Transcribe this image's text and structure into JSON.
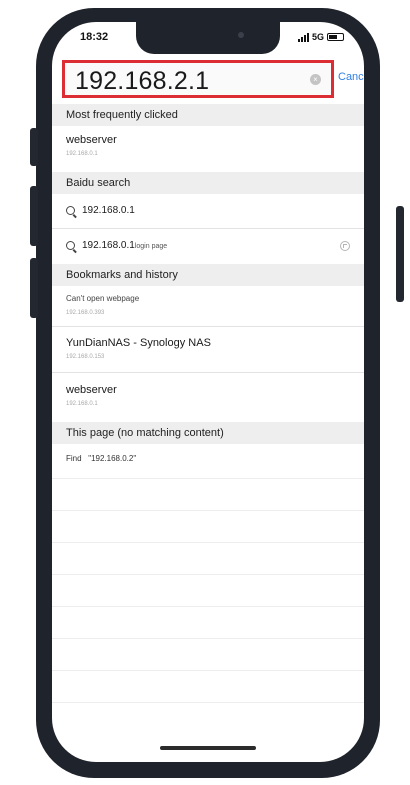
{
  "status": {
    "time": "18:32",
    "network": "5G"
  },
  "address_bar": {
    "url": "192.168.2.1",
    "cancel_label": "Cancel"
  },
  "sections": {
    "most_frequent": "Most frequently clicked",
    "baidu": "Baidu search",
    "bookmarks": "Bookmarks and history",
    "this_page": "This page (no matching content)"
  },
  "most_frequent_items": [
    {
      "title": "webserver",
      "sub": "192.168.0.1"
    }
  ],
  "baidu_items": [
    {
      "text": "192.168.0.1",
      "note": ""
    },
    {
      "text": "192.168.0.1",
      "note": "login page"
    }
  ],
  "history_items": [
    {
      "title": "Can't open webpage",
      "sub": "192.168.0.393"
    },
    {
      "title": "YunDianNAS - Synology NAS",
      "sub": "192.168.0.153"
    },
    {
      "title": "webserver",
      "sub": "192.168.0.1"
    }
  ],
  "find": {
    "label": "Find",
    "query": "\"192.168.0.2\""
  },
  "colors": {
    "highlight": "#dc2c34",
    "accent": "#2f7fe6"
  },
  "icons": [
    "clear-icon",
    "search-icon",
    "arrow-up-left-icon",
    "battery-icon",
    "signal-icon"
  ]
}
